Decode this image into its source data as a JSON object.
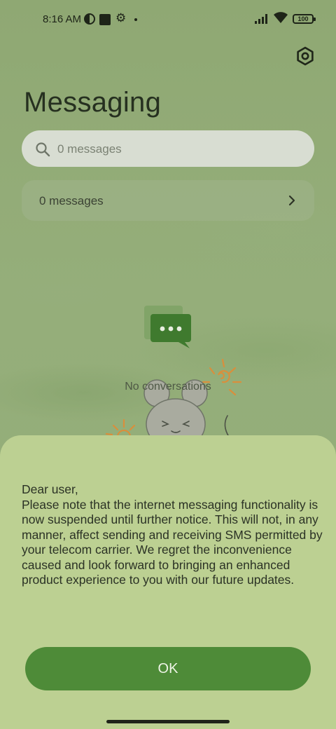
{
  "status_bar": {
    "time": "8:16 AM",
    "battery": "100",
    "icons": [
      "data-saver-icon",
      "notification-square-icon",
      "settings-gear-icon",
      "dot-icon",
      "signal-icon",
      "wifi-icon",
      "battery-icon"
    ]
  },
  "header": {
    "title": "Messaging",
    "settings_icon": "hexagon-settings-icon"
  },
  "search": {
    "placeholder": "0 messages"
  },
  "message_row": {
    "label": "0 messages"
  },
  "empty_state": {
    "text": "No conversations",
    "icon": "chat-bubble-icon"
  },
  "dialog": {
    "lines": [
      "Dear user,",
      "Please note that the internet messaging functionality is now suspended until further notice. This will not, in any manner, affect sending and receiving SMS permitted by your telecom carrier. We regret the inconvenience caused and look forward to bringing an enhanced product experience to you with our future updates."
    ],
    "ok_label": "OK"
  },
  "colors": {
    "background": "#8fa873",
    "sheet": "#bcd092",
    "primary_button": "#4e8b38",
    "chat_icon": "#3f7a2e"
  }
}
